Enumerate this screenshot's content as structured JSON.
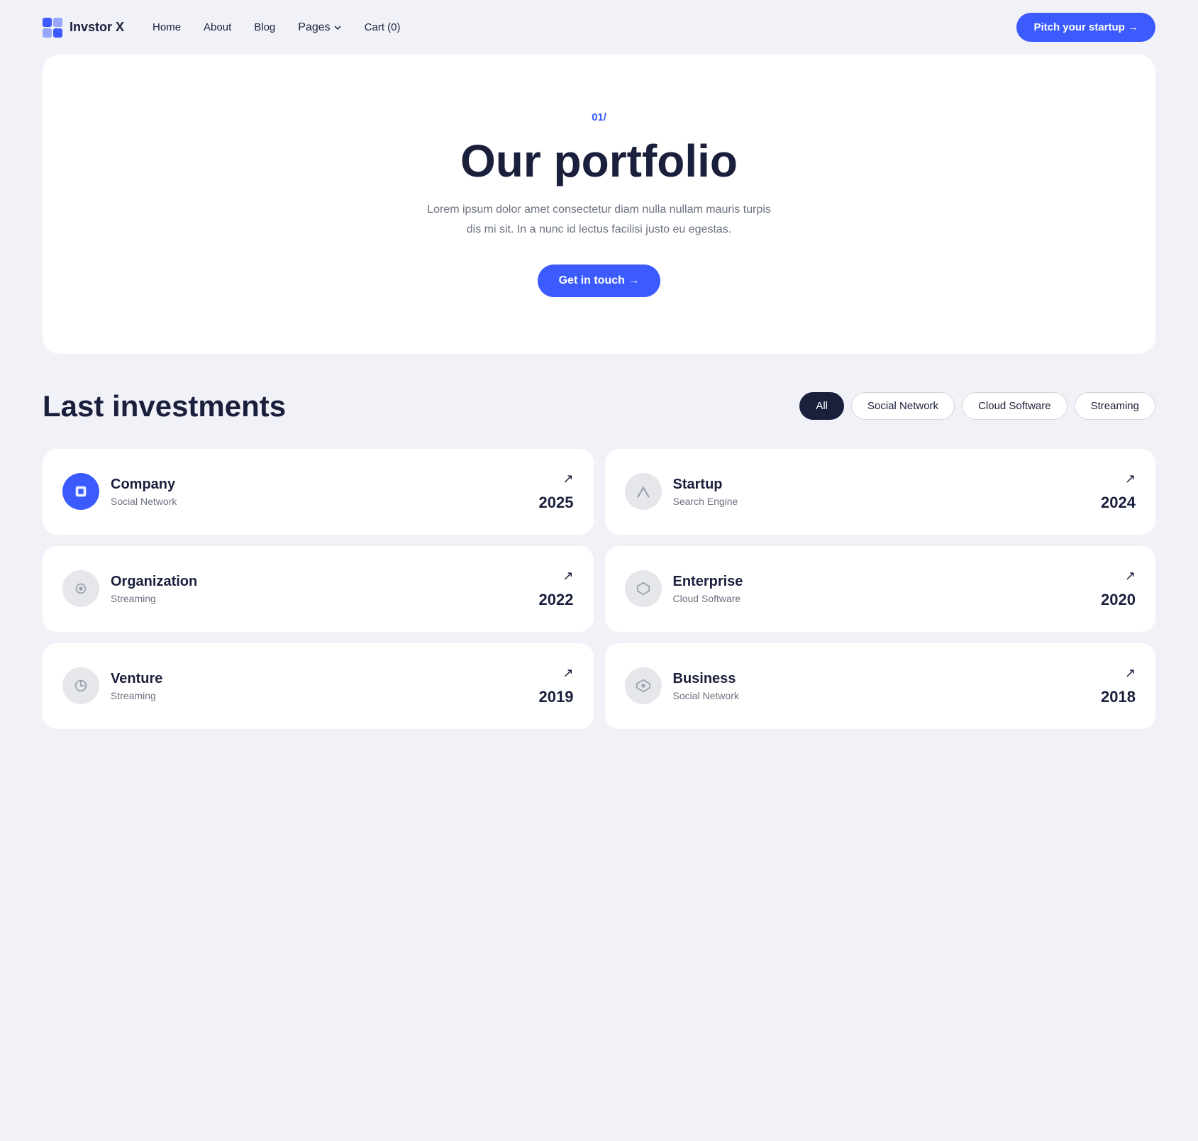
{
  "nav": {
    "logo_text": "Invstor X",
    "links": [
      {
        "label": "Home",
        "href": "#"
      },
      {
        "label": "About",
        "href": "#"
      },
      {
        "label": "Blog",
        "href": "#"
      },
      {
        "label": "Pages",
        "href": "#",
        "has_dropdown": true
      },
      {
        "label": "Cart (0)",
        "href": "#"
      }
    ],
    "cta_label": "Pitch your startup →"
  },
  "hero": {
    "section_number": "01/",
    "title": "Our portfolio",
    "description": "Lorem ipsum dolor amet consectetur diam nulla nullam mauris turpis dis mi sit. In a nunc id lectus facilisi justo eu egestas.",
    "cta_label": "Get in touch →"
  },
  "investments": {
    "title": "Last investments",
    "filters": [
      {
        "label": "All",
        "active": true
      },
      {
        "label": "Social Network",
        "active": false
      },
      {
        "label": "Cloud Software",
        "active": false
      },
      {
        "label": "Streaming",
        "active": false
      }
    ],
    "cards": [
      {
        "name": "Company",
        "category": "Social Network",
        "year": "2025",
        "icon_type": "blue",
        "icon": "◼"
      },
      {
        "name": "Startup",
        "category": "Search Engine",
        "year": "2024",
        "icon_type": "gray",
        "icon": "↗"
      },
      {
        "name": "Organization",
        "category": "Streaming",
        "year": "2022",
        "icon_type": "gray",
        "icon": "◎"
      },
      {
        "name": "Enterprise",
        "category": "Cloud Software",
        "year": "2020",
        "icon_type": "gray",
        "icon": "✦"
      },
      {
        "name": "Venture",
        "category": "Streaming",
        "year": "2019",
        "icon_type": "gray",
        "icon": "✳"
      },
      {
        "name": "Business",
        "category": "Social Network",
        "year": "2018",
        "icon_type": "gray",
        "icon": "◈"
      }
    ]
  }
}
